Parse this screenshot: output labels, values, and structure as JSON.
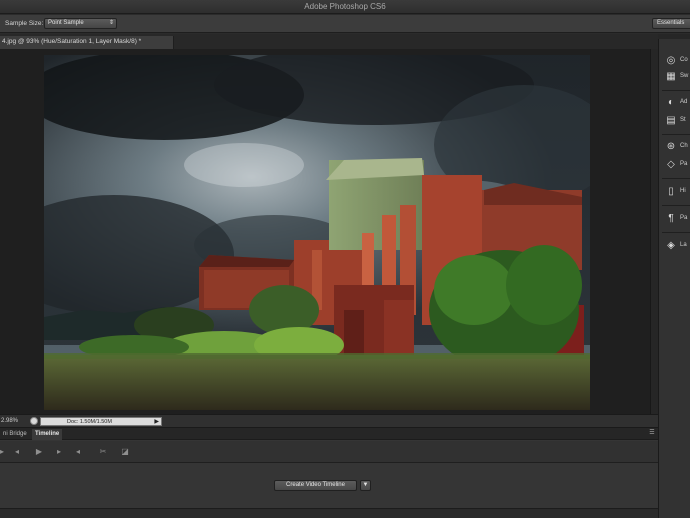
{
  "titlebar": {
    "title": "Adobe Photoshop CS6"
  },
  "options": {
    "sample_size_label": "Sample Size:",
    "sample_size_value": "Point Sample",
    "workspace": "Essentials"
  },
  "document_tab": {
    "label": "4.jpg @ 93% (Hue/Saturation 1, Layer Mask/8) *"
  },
  "status": {
    "zoom": "2.98%",
    "doc_info": "Doc: 1.50M/1.50M"
  },
  "bottom_panel": {
    "tabs": [
      {
        "label": "ni Bridge"
      },
      {
        "label": "Timeline"
      }
    ],
    "create_button": "Create Video Timeline"
  },
  "right_dock": {
    "items": [
      {
        "label": "Co",
        "icon": "color-icon"
      },
      {
        "label": "Sw",
        "icon": "swatches-icon"
      },
      {
        "label": "Ad",
        "icon": "adjustments-icon"
      },
      {
        "label": "St",
        "icon": "styles-icon"
      },
      {
        "label": "Ch",
        "icon": "channels-icon"
      },
      {
        "label": "Pa",
        "icon": "paths-icon"
      },
      {
        "label": "Hi",
        "icon": "history-icon"
      },
      {
        "label": "Pa",
        "icon": "paragraph-icon"
      },
      {
        "label": "La",
        "icon": "layers-icon"
      }
    ]
  },
  "colors": {
    "ui_dark": "#2b2b2b",
    "panel": "#353535",
    "sky": "#4f6068",
    "building_rust": "#a84a34",
    "grass": "#6a8f3a"
  }
}
